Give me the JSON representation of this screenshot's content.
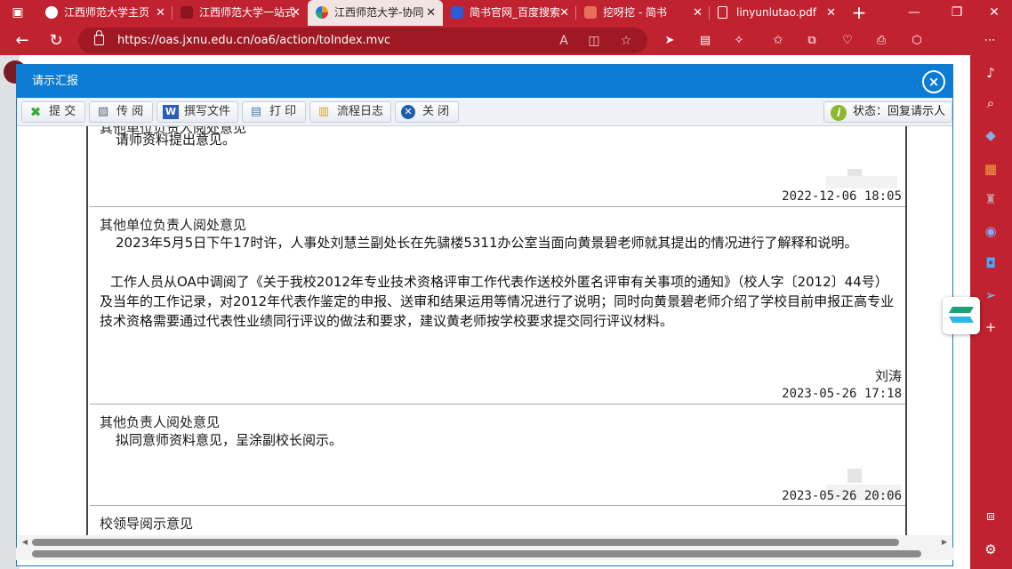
{
  "browser": {
    "tabs": [
      {
        "title": "江西师范大学主页",
        "icon_color": "#b22030",
        "active": false
      },
      {
        "title": "江西师范大学一站式",
        "icon_color": "#8a1520",
        "active": false
      },
      {
        "title": "江西师范大学-协同",
        "icon_color": "#e0a020",
        "active": true
      },
      {
        "title": "简书官网_百度搜索",
        "icon_color": "#2a5bd8",
        "active": false
      },
      {
        "title": "挖呀挖 - 简书",
        "icon_color": "#ea6f5a",
        "active": false
      },
      {
        "title": "linyunlutao.pdf",
        "icon_color": "#ffffff",
        "active": false
      }
    ],
    "new_tab": "+",
    "url": "https://oas.jxnu.edu.cn/oa6/action/toIndex.mvc"
  },
  "dialog": {
    "title": "请示汇报",
    "close": "×",
    "toolbar": {
      "submit": "提 交",
      "circulate": "传 阅",
      "write_doc": "撰写文件",
      "print": "打 印",
      "flow_log": "流程日志",
      "close": "关 闭"
    },
    "status_label": "状态：回复请示人",
    "sections": [
      {
        "title": "其他单位负责人阅处意见",
        "body": [
          "请师资料提出意见。"
        ],
        "signer": "",
        "date": "2022-12-06 18:05"
      },
      {
        "title": "其他单位负责人阅处意见",
        "body": [
          "2023年5月5日下午17时许，人事处刘慧兰副处长在先骕楼5311办公室当面向黄景碧老师就其提出的情况进行了解释和说明。",
          "工作人员从OA中调阅了《关于我校2012年专业技术资格评审工作代表作送校外匿名评审有关事项的通知》（校人字〔2012〕44号）及当年的工作记录，对2012年代表作鉴定的申报、送审和结果运用等情况进行了说明；同时向黄景碧老师介绍了学校目前申报正高专业技术资格需要通过代表性业绩同行评议的做法和要求，建议黄老师按学校要求提交同行评议材料。"
        ],
        "signer": "刘涛",
        "date": "2023-05-26 17:18"
      },
      {
        "title": "其他负责人阅处意见",
        "body": [
          "拟同意师资料意见，呈涂副校长阅示。"
        ],
        "signer": "",
        "date": "2023-05-26 20:06"
      },
      {
        "title": "校领导阅示意见",
        "body": [],
        "signer": "",
        "date": ""
      }
    ]
  }
}
